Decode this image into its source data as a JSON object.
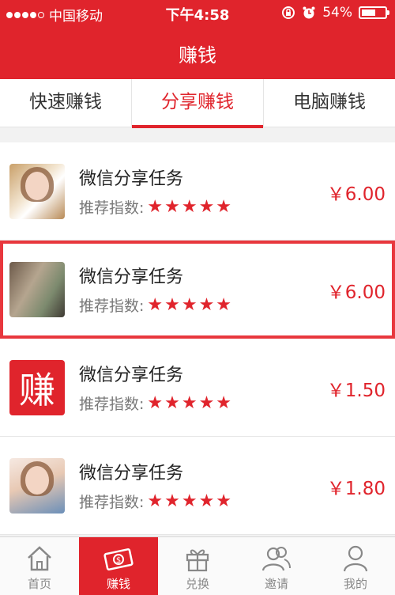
{
  "status": {
    "carrier": "中国移动",
    "time": "下午4:58",
    "battery": "54%",
    "battery_level": 0.54
  },
  "nav": {
    "title": "赚钱"
  },
  "tabs": [
    {
      "label": "快速赚钱",
      "active": false
    },
    {
      "label": "分享赚钱",
      "active": true
    },
    {
      "label": "电脑赚钱",
      "active": false
    }
  ],
  "tasks": [
    {
      "title": "微信分享任务",
      "rating_label": "推荐指数:",
      "stars": "★★★★★",
      "rating": 5,
      "price": "￥6.00"
    },
    {
      "title": "微信分享任务",
      "rating_label": "推荐指数:",
      "stars": "★★★★★",
      "rating": 5,
      "price": "￥6.00"
    },
    {
      "title": "微信分享任务",
      "rating_label": "推荐指数:",
      "stars": "★★★★★",
      "rating": 5,
      "price": "￥1.50",
      "thumb_text": "赚"
    },
    {
      "title": "微信分享任务",
      "rating_label": "推荐指数:",
      "stars": "★★★★★",
      "rating": 5,
      "price": "￥1.80"
    }
  ],
  "tabbar": [
    {
      "label": "首页",
      "icon": "home-icon"
    },
    {
      "label": "赚钱",
      "icon": "money-icon",
      "active": true
    },
    {
      "label": "兑换",
      "icon": "gift-icon"
    },
    {
      "label": "邀请",
      "icon": "users-icon"
    },
    {
      "label": "我的",
      "icon": "user-icon"
    }
  ],
  "colors": {
    "brand": "#e0242c",
    "highlight_border": "#e8373d"
  }
}
